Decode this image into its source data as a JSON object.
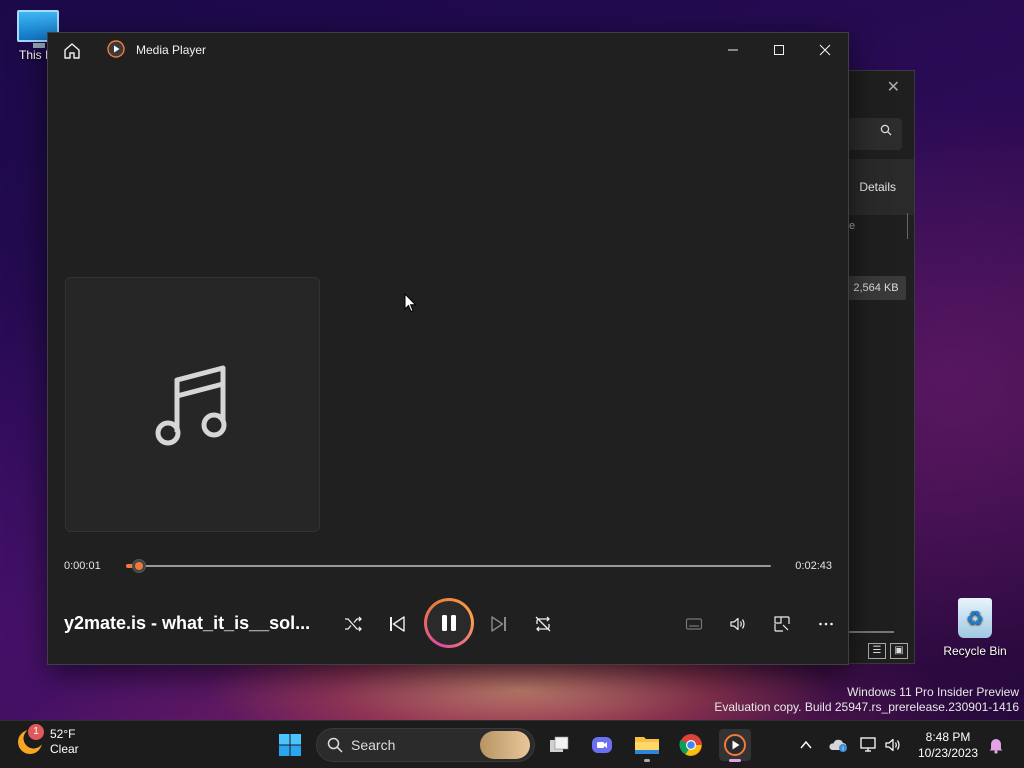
{
  "desktop": {
    "this_pc_label": "This P",
    "recycle_bin_label": "Recycle Bin"
  },
  "explorer": {
    "details_label": "Details",
    "column_fragment": "e",
    "size_value": "2,564 KB"
  },
  "player": {
    "title": "Media Player",
    "current_time": "0:00:01",
    "total_time": "0:02:43",
    "progress_fraction": 0.02,
    "track_title": "y2mate.is - what_it_is__sol...",
    "accent_color": "#f07a3c",
    "controls": {
      "shuffle": "shuffle-icon",
      "previous": "previous-icon",
      "play_pause": "pause-icon",
      "next": "next-icon",
      "repeat": "repeat-icon",
      "captions": "captions-icon",
      "volume": "volume-icon",
      "mini_player": "mini-player-icon",
      "more": "more-icon"
    }
  },
  "watermark": {
    "line1": "Windows 11 Pro Insider Preview",
    "line2": "Evaluation copy. Build 25947.rs_prerelease.230901-1416"
  },
  "taskbar": {
    "weather_temp": "52°F",
    "weather_cond": "Clear",
    "weather_badge": "1",
    "search_label": "Search",
    "time": "8:48 PM",
    "date": "10/23/2023"
  }
}
